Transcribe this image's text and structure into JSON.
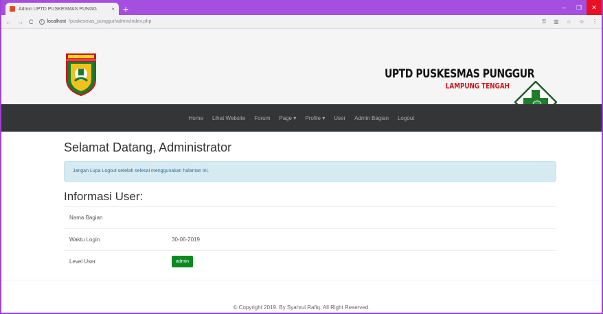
{
  "browser": {
    "tab_title": "Admin UPTD PUSKESMAS PUNGG",
    "tab_close": "×",
    "new_tab": "+",
    "url_host": "localhost",
    "url_path": "/puskesmas_punggur/admin/index.php",
    "win_min": "–",
    "win_max": "❐",
    "win_close": "✕"
  },
  "header": {
    "brand_title": "UPTD PUSKESMAS PUNGGUR",
    "brand_subtitle": "LAMPUNG TENGAH"
  },
  "nav": {
    "items": [
      "Home",
      "Lihat Website",
      "Forum",
      "Page ▾",
      "Profile ▾",
      "User",
      "Admin Bagian",
      "Logout"
    ]
  },
  "main": {
    "welcome": "Selamat Datang, Administrator",
    "alert": "Jangan Lupa Logout setelah selesai menggunakan halaman ini.",
    "info_title": "Informasi User:",
    "rows": [
      {
        "label": "Nama Bagian",
        "value": ""
      },
      {
        "label": "Waktu Login",
        "value": "30-06-2019"
      },
      {
        "label": "Level User",
        "value": "admin"
      }
    ]
  },
  "footer": {
    "text": "© Copyright 2019. By Syahrul Rafiq. All Right Reserved."
  },
  "colors": {
    "tabbar": "#a54fe0",
    "navbar": "#333537",
    "badge": "#0a8a21",
    "alert_bg": "#d6eaf2"
  }
}
